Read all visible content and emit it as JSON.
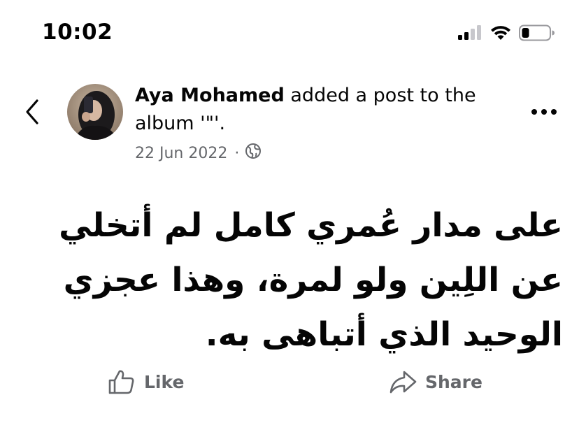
{
  "status_bar": {
    "time": "10:02"
  },
  "post": {
    "author": "Aya Mohamed",
    "action_text": " added a post to the album '\"'.",
    "date": "22 Jun 2022",
    "separator": "·",
    "privacy_icon": "globe-icon",
    "text": "على مدار عُمري كامل لم أتخلي عن اللِين ولو لمرة، وهذا عجزي الوحيد الذي أتباهى به."
  },
  "actions": {
    "like_label": "Like",
    "share_label": "Share"
  },
  "colors": {
    "text_primary": "#050505",
    "text_secondary": "#65676b",
    "background": "#ffffff"
  }
}
